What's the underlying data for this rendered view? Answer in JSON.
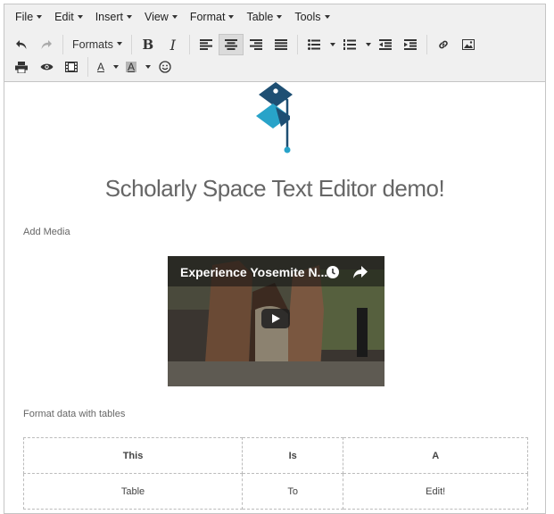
{
  "menubar": {
    "items": [
      {
        "label": "File"
      },
      {
        "label": "Edit"
      },
      {
        "label": "Insert"
      },
      {
        "label": "View"
      },
      {
        "label": "Format"
      },
      {
        "label": "Table"
      },
      {
        "label": "Tools"
      }
    ]
  },
  "toolbar": {
    "formats_label": "Formats",
    "bold_label": "B",
    "italic_label": "I",
    "text_color_label": "A",
    "bg_color_label": "A",
    "active_alignment": "center"
  },
  "content": {
    "title": "Scholarly Space Text Editor demo!",
    "add_media_label": "Add Media",
    "video_title": "Experience Yosemite N...",
    "tables_label": "Format data with tables",
    "table": {
      "rows": [
        [
          "This",
          "Is",
          "A"
        ],
        [
          "Table",
          "To",
          "Edit!"
        ]
      ]
    }
  },
  "colors": {
    "logo_dark": "#1e4f73",
    "logo_light": "#28a3c9",
    "toolbar_bg": "#f0f0f0"
  }
}
